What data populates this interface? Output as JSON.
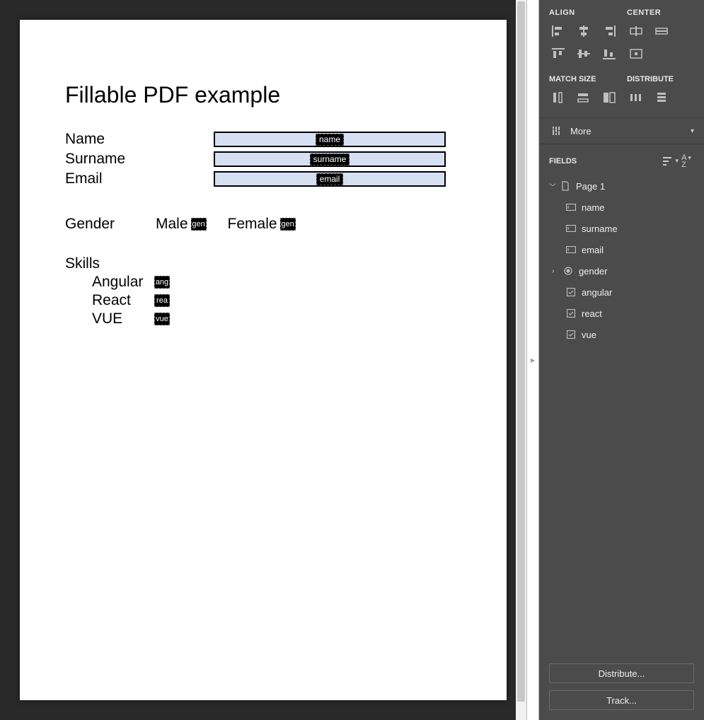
{
  "doc": {
    "title": "Fillable PDF example",
    "rows": [
      {
        "label": "Name",
        "field_tag": "name"
      },
      {
        "label": "Surname",
        "field_tag": "surname"
      },
      {
        "label": "Email",
        "field_tag": "email"
      }
    ],
    "gender": {
      "label": "Gender",
      "options": [
        {
          "text": "Male",
          "tag": "gen"
        },
        {
          "text": "Female",
          "tag": "gen"
        }
      ]
    },
    "skills": {
      "label": "Skills",
      "items": [
        {
          "text": "Angular",
          "tag": "ang"
        },
        {
          "text": "React",
          "tag": "rea"
        },
        {
          "text": "VUE",
          "tag": "vue"
        }
      ]
    }
  },
  "panel": {
    "align_label": "ALIGN",
    "center_label": "CENTER",
    "match_label": "MATCH SIZE",
    "distribute_label": "DISTRIBUTE",
    "more_label": "More",
    "fields_label": "FIELDS",
    "tree": {
      "page_label": "Page 1",
      "items": [
        {
          "type": "text",
          "name": "name"
        },
        {
          "type": "text",
          "name": "surname"
        },
        {
          "type": "text",
          "name": "email"
        },
        {
          "type": "group",
          "name": "gender"
        },
        {
          "type": "check",
          "name": "angular"
        },
        {
          "type": "check",
          "name": "react"
        },
        {
          "type": "check",
          "name": "vue"
        }
      ]
    },
    "distribute_btn": "Distribute...",
    "track_btn": "Track..."
  }
}
